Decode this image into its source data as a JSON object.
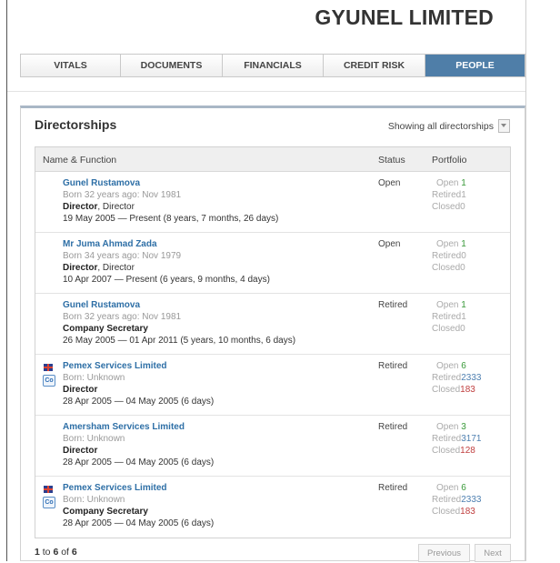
{
  "header": {
    "company_name": "GYUNEL LIMITED"
  },
  "tabs": [
    {
      "label": "VITALS",
      "active": false
    },
    {
      "label": "DOCUMENTS",
      "active": false
    },
    {
      "label": "FINANCIALS",
      "active": false
    },
    {
      "label": "CREDIT RISK",
      "active": false
    },
    {
      "label": "PEOPLE",
      "active": true
    }
  ],
  "panel": {
    "title": "Directorships",
    "filter_label": "Showing all directorships",
    "columns": {
      "name": "Name & Function",
      "status": "Status",
      "portfolio": "Portfolio"
    }
  },
  "rows": [
    {
      "name": "Gunel Rustamova",
      "born": "Born 32 years ago: Nov 1981",
      "role": "Director",
      "role_detail": ", Director",
      "dates": "19 May 2005 — Present (8 years, 7 months, 26 days)",
      "status": "Open",
      "company": false,
      "open": "1",
      "retired": "1",
      "closed": "0"
    },
    {
      "name": "Mr Juma Ahmad Zada",
      "born": "Born 34 years ago: Nov 1979",
      "role": "Director",
      "role_detail": ", Director",
      "dates": "10 Apr 2007 — Present (6 years, 9 months, 4 days)",
      "status": "Open",
      "company": false,
      "open": "1",
      "retired": "0",
      "closed": "0"
    },
    {
      "name": "Gunel Rustamova",
      "born": "Born 32 years ago: Nov 1981",
      "role": "Company Secretary",
      "role_detail": "",
      "dates": "26 May 2005 — 01 Apr 2011 (5 years, 10 months, 6 days)",
      "status": "Retired",
      "company": false,
      "open": "1",
      "retired": "1",
      "closed": "0"
    },
    {
      "name": "Pemex Services Limited",
      "born": "Born: Unknown",
      "role": "Director",
      "role_detail": "",
      "dates": "28 Apr 2005 — 04 May 2005 (6 days)",
      "status": "Retired",
      "company": true,
      "open": "6",
      "retired": "2333",
      "closed": "183"
    },
    {
      "name": "Amersham Services Limited",
      "born": "Born: Unknown",
      "role": "Director",
      "role_detail": "",
      "dates": "28 Apr 2005 — 04 May 2005 (6 days)",
      "status": "Retired",
      "company": false,
      "open": "3",
      "retired": "3171",
      "closed": "128"
    },
    {
      "name": "Pemex Services Limited",
      "born": "Born: Unknown",
      "role": "Company Secretary",
      "role_detail": "",
      "dates": "28 Apr 2005 — 04 May 2005 (6 days)",
      "status": "Retired",
      "company": true,
      "open": "6",
      "retired": "2333",
      "closed": "183"
    }
  ],
  "portfolio_labels": {
    "open": "Open",
    "retired": "Retired",
    "closed": "Closed"
  },
  "badge_text": "Co",
  "pager": {
    "from": "1",
    "to_label": " to ",
    "to": "6",
    "of_label": " of ",
    "total": "6",
    "prev_label": "Previous",
    "next_label": "Next"
  },
  "colors": {
    "accent": "#4f7ea8",
    "link": "#2e6fa6",
    "open": "#3a9a3a",
    "closed": "#c04040"
  }
}
